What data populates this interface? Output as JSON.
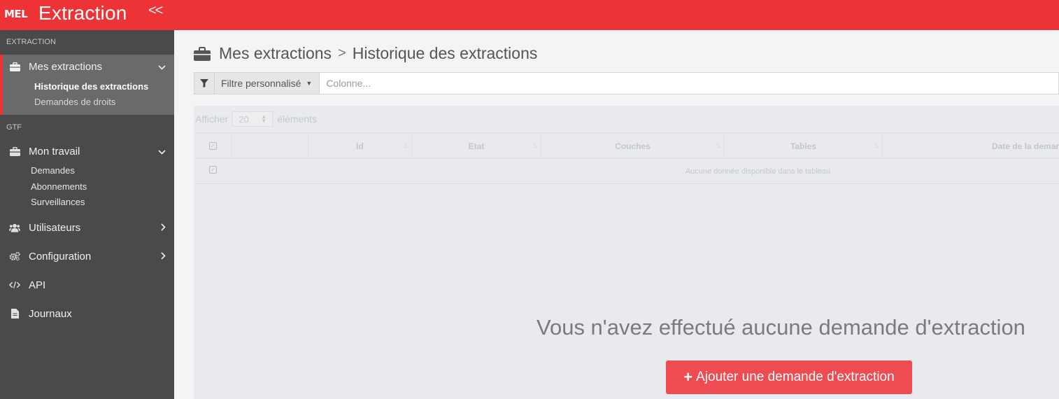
{
  "brand": {
    "logo": "MEL",
    "app_name": "Extraction",
    "collapse": "<<"
  },
  "sidebar": {
    "section_extraction": "EXTRACTION",
    "mes_extractions": {
      "label": "Mes extractions",
      "icon": "briefcase-icon"
    },
    "sub_historique": "Historique des extractions",
    "sub_demandes_droits": "Demandes de droits",
    "section_gtf": "GTF",
    "mon_travail": {
      "label": "Mon travail",
      "icon": "briefcase-icon"
    },
    "sub_demandes": "Demandes",
    "sub_abonnements": "Abonnements",
    "sub_surveillances": "Surveillances",
    "utilisateurs": {
      "label": "Utilisateurs",
      "icon": "users-icon"
    },
    "configuration": {
      "label": "Configuration",
      "icon": "gears-icon"
    },
    "api": {
      "label": "API",
      "icon": "code-icon"
    },
    "journaux": {
      "label": "Journaux",
      "icon": "file-icon"
    }
  },
  "main": {
    "title_parent": "Mes extractions",
    "title_sep": ">",
    "title_current": "Historique des extractions",
    "filter": {
      "label": "Filtre personnalisé",
      "placeholder": "Colonne..."
    },
    "length": {
      "prefix": "Afficher",
      "value": "20",
      "suffix": "éléments"
    },
    "table": {
      "columns": [
        "Id",
        "Etat",
        "Couches",
        "Tables",
        "Date de la demande"
      ],
      "empty": "Aucune donnée disponible dans le tableau"
    },
    "empty_message": "Vous n'avez effectué aucune demande d'extraction",
    "add_button": "Ajouter une demande d'extraction"
  },
  "colors": {
    "accent": "#ee3337",
    "sidebar": "#4a4a4a",
    "button": "#ee4b52"
  }
}
